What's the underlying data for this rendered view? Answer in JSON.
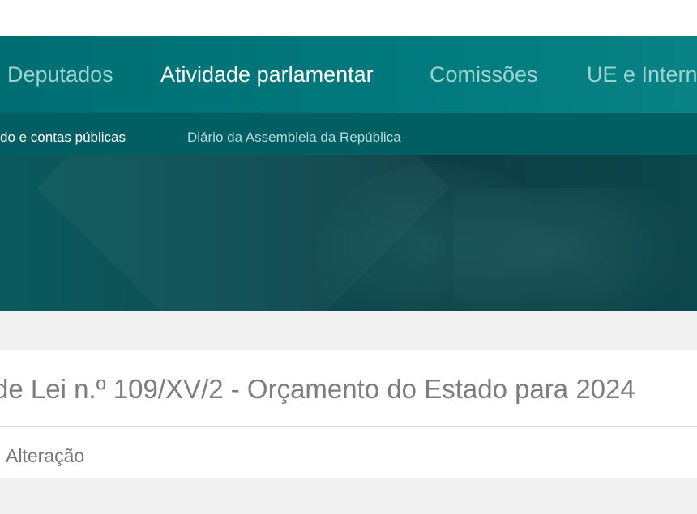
{
  "main_nav": {
    "items": [
      {
        "label": "Deputados"
      },
      {
        "label": "Atividade parlamentar"
      },
      {
        "label": "Comissões"
      },
      {
        "label": "UE e Intern"
      }
    ]
  },
  "sub_nav": {
    "items": [
      {
        "label": "do e contas públicas"
      },
      {
        "label": "Diário da Assembleia da República"
      }
    ]
  },
  "page": {
    "title": "de Lei n.º 109/XV/2 - Orçamento do Estado para 2024",
    "type": "Alteração"
  },
  "colors": {
    "nav_bg": "#007a7d",
    "subnav_bg": "#015f63",
    "hero_bg": "#0d3f44"
  }
}
